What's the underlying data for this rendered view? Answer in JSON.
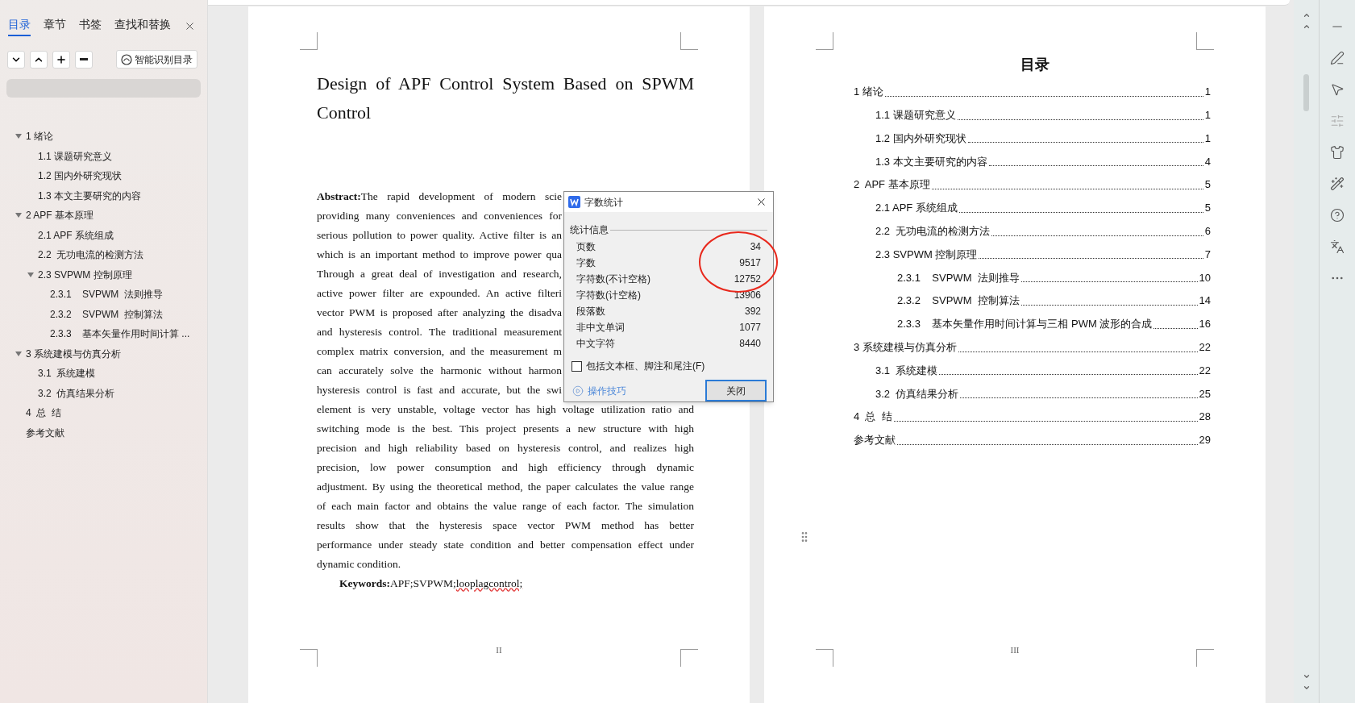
{
  "sidebar": {
    "tabs": [
      {
        "label": "目录",
        "selected": true
      },
      {
        "label": "章节",
        "selected": false
      },
      {
        "label": "书签",
        "selected": false
      },
      {
        "label": "查找和替换",
        "selected": false
      }
    ],
    "smart_button": "智能识别目录",
    "tree": [
      {
        "label": "1 绪论",
        "expanded": true,
        "children": [
          {
            "label": "1.1 课题研究意义"
          },
          {
            "label": "1.2 国内外研究现状"
          },
          {
            "label": "1.3 本文主要研究的内容"
          }
        ]
      },
      {
        "label": "2 APF 基本原理",
        "expanded": true,
        "children": [
          {
            "label": "2.1 APF 系统组成"
          },
          {
            "label": "2.2  无功电流的检测方法"
          },
          {
            "label": "2.3 SVPWM 控制原理",
            "expanded": true,
            "children": [
              {
                "label": "2.3.1    SVPWM  法则推导"
              },
              {
                "label": "2.3.2    SVPWM  控制算法"
              },
              {
                "label": "2.3.3    基本矢量作用时间计算 ..."
              }
            ]
          }
        ]
      },
      {
        "label": "3 系统建模与仿真分析",
        "expanded": true,
        "children": [
          {
            "label": "3.1  系统建模"
          },
          {
            "label": "3.2  仿真结果分析"
          }
        ]
      },
      {
        "label": "4  总  结"
      },
      {
        "label": "参考文献"
      }
    ]
  },
  "page_1": {
    "title": "Design of APF Control System Based on SPWM Control",
    "abstract_lines": [
      {
        "kind": "covered",
        "text": "**Abstract:**The rapid development of modern scie"
      },
      {
        "kind": "covered",
        "text": "providing many conveniences and conveniences for"
      },
      {
        "kind": "covered",
        "text": "serious pollution to power quality. Active filter is an"
      },
      {
        "kind": "covered",
        "text": "which is an important method to improve power qua"
      },
      {
        "kind": "covered",
        "text": "Through a great deal of investigation and research,"
      },
      {
        "kind": "covered",
        "text": "active power filter are expounded. An active filteri"
      },
      {
        "kind": "covered",
        "text": "vector PWM is proposed after analyzing the disadva"
      },
      {
        "kind": "covered",
        "text": "and hysteresis control. The traditional measurement"
      },
      {
        "kind": "covered",
        "text": "complex matrix conversion, and the measurement m"
      },
      {
        "kind": "covered",
        "text": "can accurately solve the harmonic without harmon"
      },
      {
        "kind": "covered",
        "text": "hysteresis control is fast and accurate, but the swi"
      },
      {
        "kind": "full",
        "text": "element is very unstable, voltage vector has high voltage utilization ratio and"
      },
      {
        "kind": "full",
        "text": "switching mode is the best. This project presents a new structure with high"
      },
      {
        "kind": "full",
        "text": "precision and high reliability based on hysteresis control, and realizes high"
      },
      {
        "kind": "full",
        "text": "precision, low power consumption and high efficiency through dynamic"
      },
      {
        "kind": "full",
        "text": "adjustment. By using the theoretical method, the paper calculates the value range"
      },
      {
        "kind": "full",
        "text": "of each main factor and obtains the value range of each factor. The simulation"
      },
      {
        "kind": "full",
        "text": "results show that the hysteresis space vector PWM method has better"
      },
      {
        "kind": "full",
        "text": "performance under steady state condition and better compensation effect under"
      },
      {
        "kind": "last",
        "text": "dynamic condition."
      }
    ],
    "keywords_label": "Keywords:",
    "keywords": "APF;SVPWM;",
    "keywords_misspelled": "looplagcontrol;",
    "page_number": "II"
  },
  "page_2": {
    "title": "目录",
    "toc": [
      {
        "label": "1 绪论",
        "page": "1",
        "children": [
          {
            "label": "1.1 课题研究意义",
            "page": "1"
          },
          {
            "label": "1.2 国内外研究现状",
            "page": "1"
          },
          {
            "label": "1.3 本文主要研究的内容",
            "page": "4"
          }
        ]
      },
      {
        "label": "2  APF 基本原理",
        "page": "5",
        "children": [
          {
            "label": "2.1 APF 系统组成",
            "page": "5"
          },
          {
            "label": "2.2  无功电流的检测方法",
            "page": "6"
          },
          {
            "label": "2.3 SVPWM 控制原理",
            "page": "7",
            "children": [
              {
                "label": "2.3.1    SVPWM  法则推导",
                "page": "10"
              },
              {
                "label": "2.3.2    SVPWM  控制算法",
                "page": "14"
              },
              {
                "label": "2.3.3    基本矢量作用时间计算与三相 PWM 波形的合成",
                "page": "16"
              }
            ]
          }
        ]
      },
      {
        "label": "3 系统建模与仿真分析",
        "page": "22",
        "children": [
          {
            "label": "3.1  系统建模",
            "page": "22"
          },
          {
            "label": "3.2  仿真结果分析",
            "page": "25"
          }
        ]
      },
      {
        "label": "4  总  结",
        "page": "28"
      },
      {
        "label": "参考文献",
        "page": "29"
      }
    ],
    "page_number": "III"
  },
  "dialog": {
    "title": "字数统计",
    "group": "统计信息",
    "stats": [
      {
        "label": "页数",
        "value": "34"
      },
      {
        "label": "字数",
        "value": "9517"
      },
      {
        "label": "字符数(不计空格)",
        "value": "12752"
      },
      {
        "label": "字符数(计空格)",
        "value": "13906"
      },
      {
        "label": "段落数",
        "value": "392"
      },
      {
        "label": "非中文单词",
        "value": "1077"
      },
      {
        "label": "中文字符",
        "value": "8440"
      }
    ],
    "checkbox": {
      "label": "包括文本框、脚注和尾注(F)",
      "checked": false
    },
    "tips_link": "操作技巧",
    "close_button": "关闭"
  }
}
